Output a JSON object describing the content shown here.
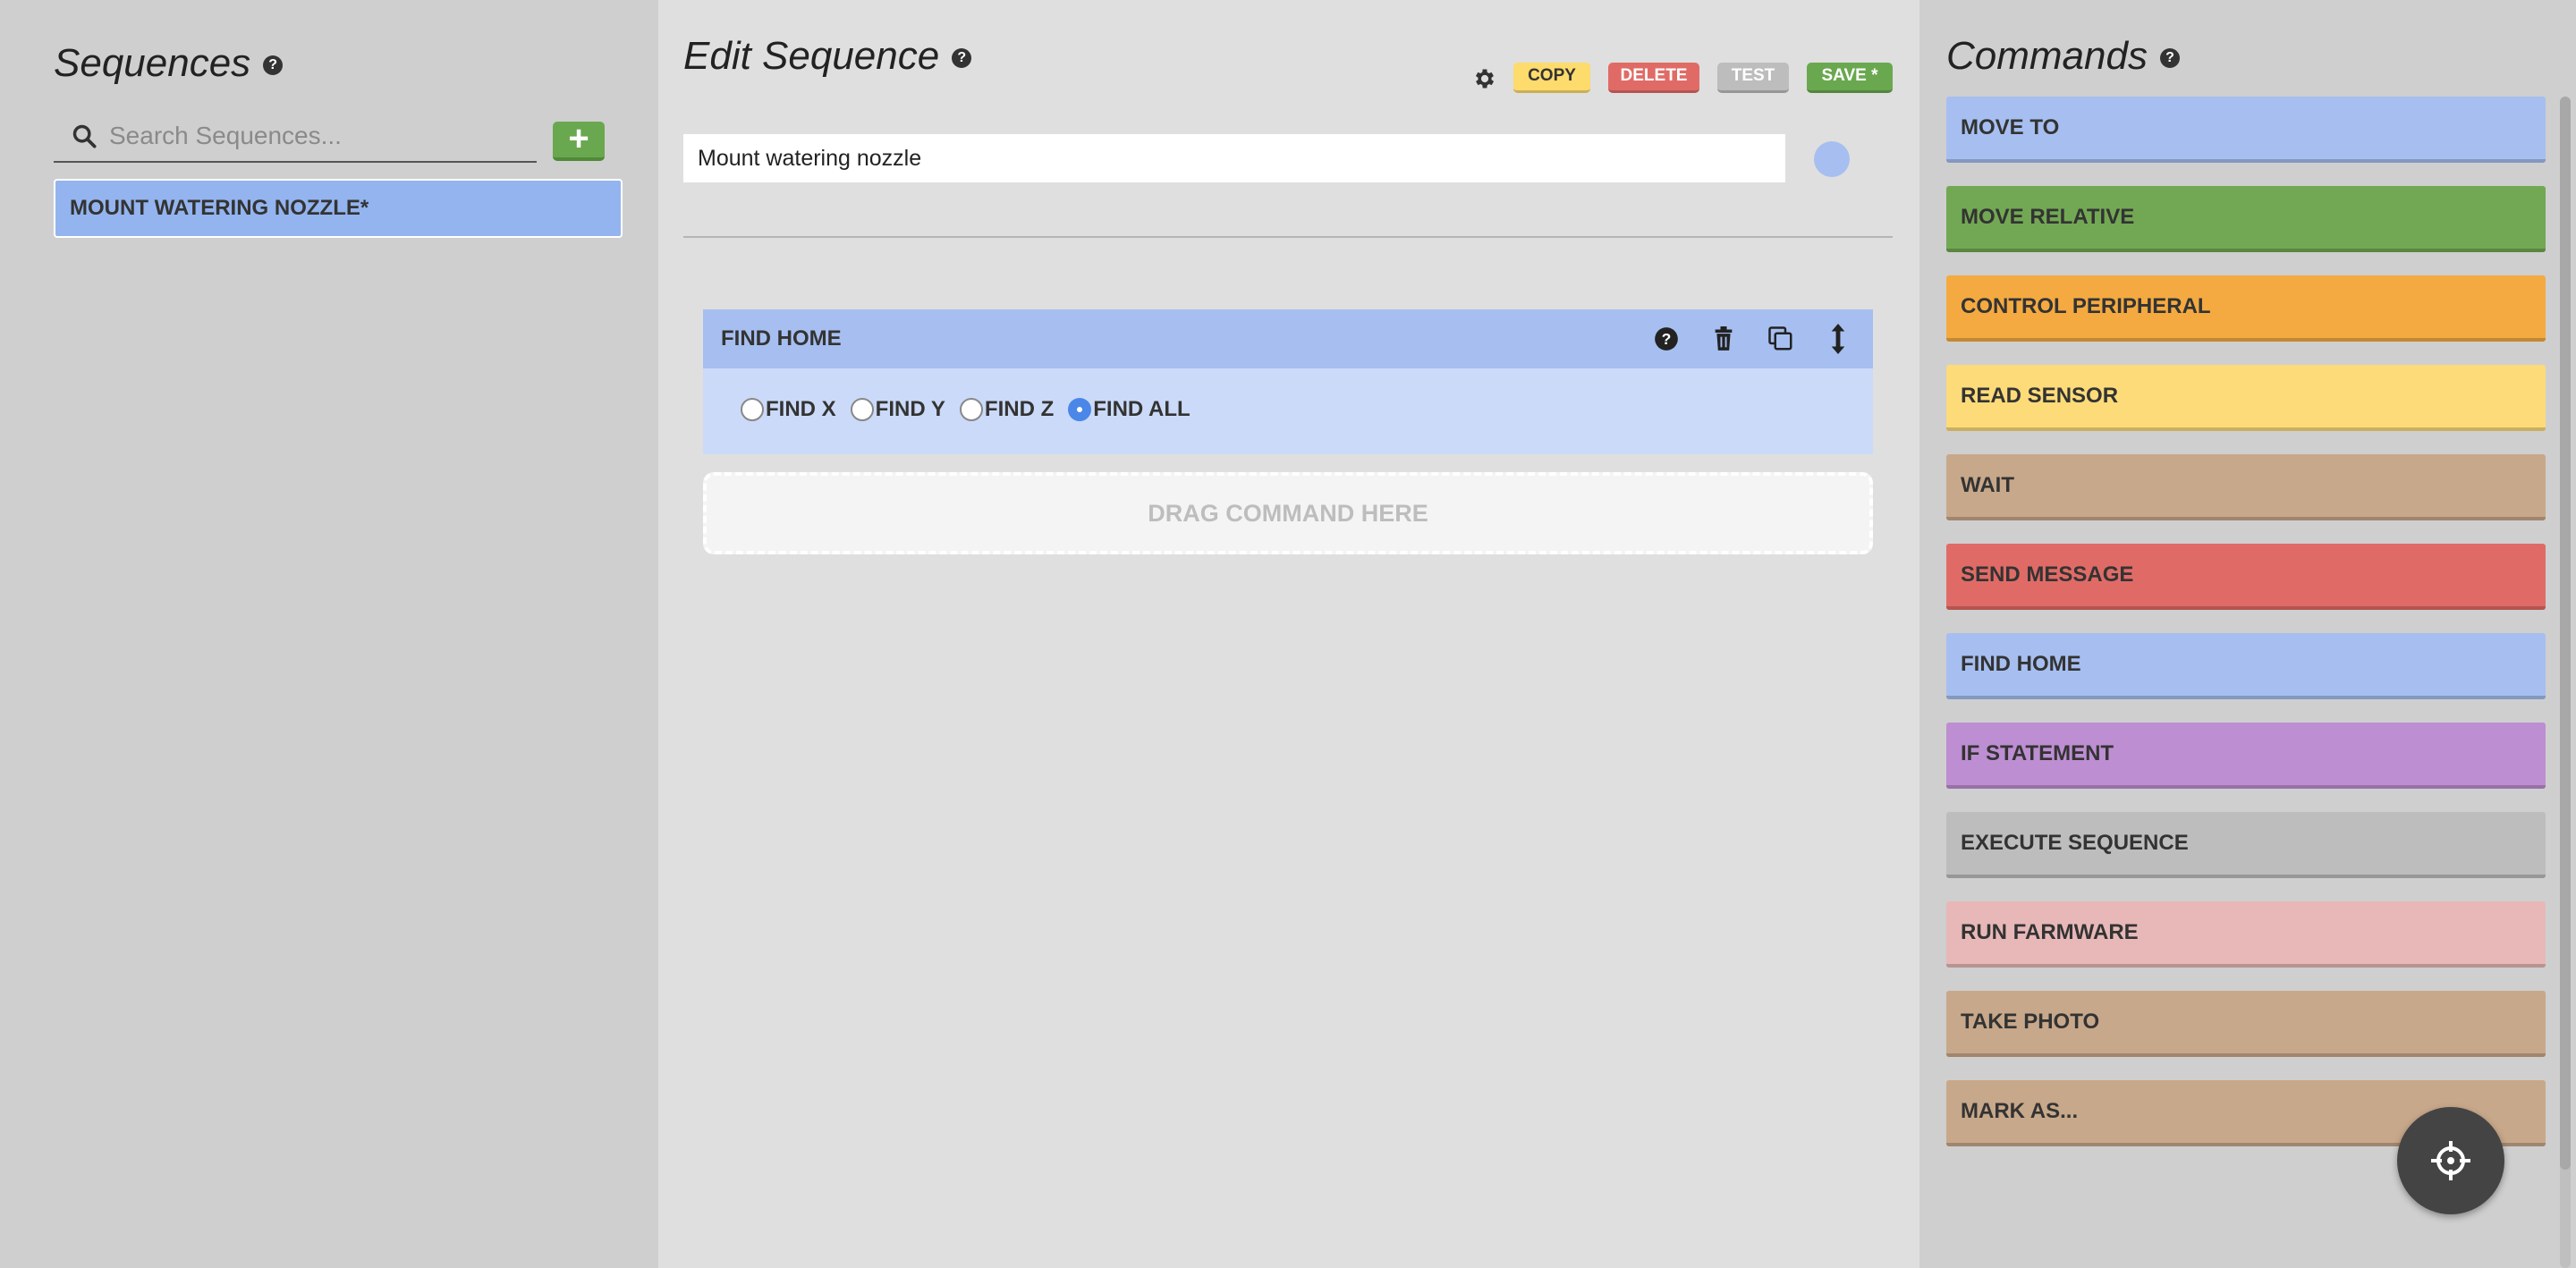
{
  "sequences_panel": {
    "title": "Sequences",
    "search": {
      "placeholder": "Search Sequences...",
      "value": ""
    },
    "add_label": "+",
    "items": [
      {
        "label": "MOUNT WATERING NOZZLE*"
      }
    ]
  },
  "editor": {
    "title": "Edit Sequence",
    "buttons": {
      "copy": "COPY",
      "delete": "DELETE",
      "test": "TEST",
      "save": "SAVE *"
    },
    "name_value": "Mount watering nozzle",
    "color": "#a6bff0",
    "steps": [
      {
        "title": "FIND HOME",
        "options": [
          "FIND X",
          "FIND Y",
          "FIND Z",
          "FIND ALL"
        ],
        "selected": "FIND ALL"
      }
    ],
    "drop_zone_label": "DRAG COMMAND HERE"
  },
  "commands_panel": {
    "title": "Commands",
    "items": [
      {
        "label": "MOVE TO",
        "color": "#a6bff0"
      },
      {
        "label": "MOVE RELATIVE",
        "color": "#72a853"
      },
      {
        "label": "CONTROL PERIPHERAL",
        "color": "#f4aa41"
      },
      {
        "label": "READ SENSOR",
        "color": "#fddb79"
      },
      {
        "label": "WAIT",
        "color": "#c8a88a"
      },
      {
        "label": "SEND MESSAGE",
        "color": "#e06b66"
      },
      {
        "label": "FIND HOME",
        "color": "#a6bff0"
      },
      {
        "label": "IF STATEMENT",
        "color": "#bd8ed1"
      },
      {
        "label": "EXECUTE SEQUENCE",
        "color": "#bdbdbd"
      },
      {
        "label": "RUN FARMWARE",
        "color": "#e8b8b8"
      },
      {
        "label": "TAKE PHOTO",
        "color": "#c8a88a"
      },
      {
        "label": "MARK AS...",
        "color": "#c8a88a"
      }
    ]
  },
  "icons": {
    "help": "question-circle-icon",
    "search": "search-icon",
    "settings": "gear-icon",
    "trash": "trash-icon",
    "duplicate": "copy-icon",
    "drag": "vertical-arrows-icon",
    "fab": "crosshair-icon"
  }
}
